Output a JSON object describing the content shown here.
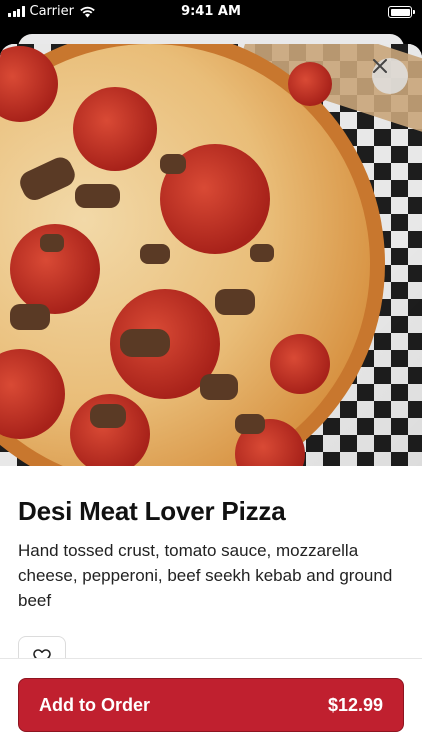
{
  "status_bar": {
    "carrier": "Carrier",
    "time": "9:41 AM"
  },
  "item": {
    "name": "Desi Meat Lover Pizza",
    "description": "Hand tossed crust, tomato sauce, mozzarella cheese, pepperoni, beef seekh kebab and ground beef",
    "image_icon": "pizza-photo"
  },
  "actions": {
    "close_icon": "close-icon",
    "favorite_icon": "heart-icon",
    "add_to_order_label": "Add to Order",
    "price": "$12.99"
  },
  "colors": {
    "accent": "#c0202f",
    "accent_border": "#8e1420",
    "close_bg": "#e1e1e1"
  }
}
